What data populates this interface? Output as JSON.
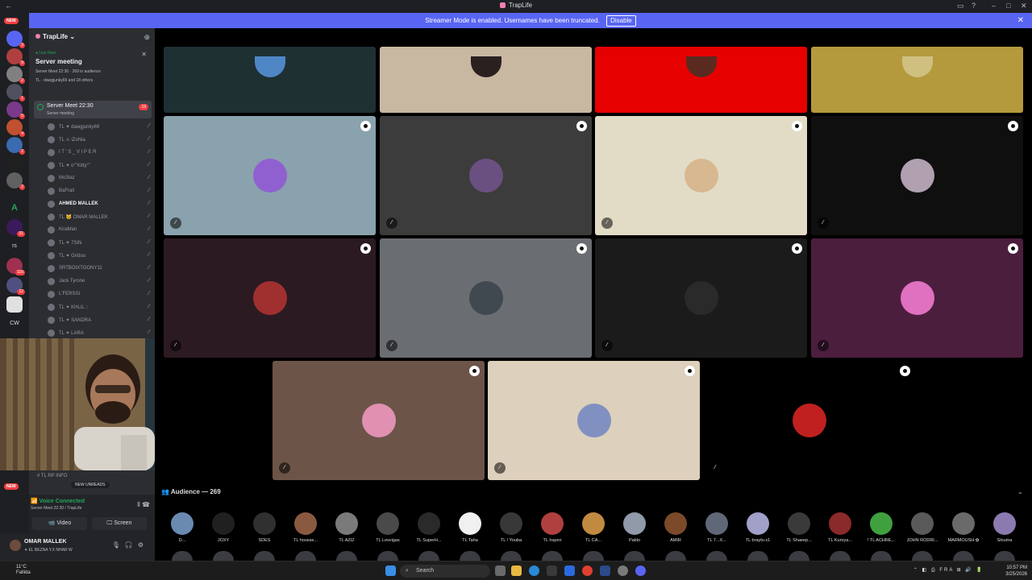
{
  "window": {
    "title": "TrapLife"
  },
  "banner": {
    "message": "Streamer Mode is enabled. Usernames have been truncated.",
    "disable_label": "Disable"
  },
  "rail": {
    "new_label": "NEW",
    "new_label_bottom": "NEW",
    "text_icon_1": "A",
    "text_icon_2": "rs",
    "text_icon_3": "CW"
  },
  "sidebar": {
    "server_name": "TrapLife",
    "live": {
      "status": "Live Now",
      "title": "Server meeting",
      "info": "Server Meet 22:30 · 269 in audience",
      "users": "TL · dawgjunky69 and 18 others"
    },
    "stage_channel": {
      "name": "Server Meet 22:30",
      "subtitle": "Server meeting",
      "count": "19"
    },
    "members": [
      "TL ✦ dawgjunky69",
      "TL ⚔ iZoNia",
      "I T ' S _ V I P E R",
      "TL ✦ o°˚Kitty°˚",
      "Mo3taz",
      "BaFrali",
      "AHMED MALLEK",
      "TL 🐱 OMAR MALLEK",
      "KiraMan",
      "TL ✦ 7SIN",
      "TL ✦ Gridou",
      "SRTBOIXTOONY11",
      "Jack Tyrone",
      "L'FERSSI",
      "TL ✦ KHLIL ::",
      "TL ✦ SANDRA",
      "TL ✦ LARA"
    ],
    "rp_channel": "TL RP INFO",
    "new_unreads": "NEW UNREADS",
    "voice": {
      "status": "Voice Connected",
      "sub": "Server Meet 22:30 / TrapLife",
      "video_label": "Video",
      "screen_label": "Screen"
    },
    "user": {
      "name": "OMAR MALLEK",
      "status": "✦ EL BEZNA Y.X NHAR W"
    }
  },
  "stage": {
    "tiles": [
      {
        "bg": "#1f3033",
        "avatar": "#4f86c6"
      },
      {
        "bg": "#c8b8a2",
        "avatar": "#2a2020"
      },
      {
        "bg": "#e60000",
        "avatar": "#5a2a20"
      },
      {
        "bg": "#b49a3c",
        "avatar": "#d0c080"
      },
      {
        "bg": "#8aa2ae",
        "avatar": "#9060d0"
      },
      {
        "bg": "#3c3c3c",
        "avatar": "#6a5080"
      },
      {
        "bg": "#e2dcc6",
        "avatar": "#d8b890"
      },
      {
        "bg": "#0f0f0f",
        "avatar": "#b0a0b0"
      },
      {
        "bg": "#2c1a22",
        "avatar": "#a03030"
      },
      {
        "bg": "#6a6e72",
        "avatar": "#404850"
      },
      {
        "bg": "#1b1b1b",
        "avatar": "#2a2a2a"
      },
      {
        "bg": "#4c1e3e",
        "avatar": "#e070c0"
      },
      {
        "bg": "#6c5448",
        "avatar": "#e090b0"
      },
      {
        "bg": "#ddd0bc",
        "avatar": "#8090c0"
      },
      {
        "bg": "#000000",
        "avatar": "#c02020"
      }
    ]
  },
  "audience": {
    "header": "Audience — 269",
    "members": [
      {
        "name": "D...",
        "color": "#6a8ab0"
      },
      {
        "name": "JOXY",
        "color": "#202020"
      },
      {
        "name": "SDES",
        "color": "#303030"
      },
      {
        "name": "TL housse...",
        "color": "#8a5a40"
      },
      {
        "name": "TL AZIZ",
        "color": "#7a7a7a"
      },
      {
        "name": "TL Lesvigas",
        "color": "#4a4a4a"
      },
      {
        "name": "TL SuperH...",
        "color": "#2a2a2a"
      },
      {
        "name": "TL Taha",
        "color": "#f0f0f0"
      },
      {
        "name": "TL ! Youba",
        "color": "#383838"
      },
      {
        "name": "TL Irayen",
        "color": "#b04040"
      },
      {
        "name": "TL CA...",
        "color": "#c08a40"
      },
      {
        "name": "Pablo",
        "color": "#909aa8"
      },
      {
        "name": "AMIR",
        "color": "#7a4a2a"
      },
      {
        "name": "TL 7...X...",
        "color": "#606878"
      },
      {
        "name": "TL brayto.x1",
        "color": "#a0a0c8"
      },
      {
        "name": "TL Shaeep...",
        "color": "#3a3a3a"
      },
      {
        "name": "TL Kuroya...",
        "color": "#8a2a2a"
      },
      {
        "name": "! TL ACHRE...",
        "color": "#40a040"
      },
      {
        "name": "JOHN RODRI...",
        "color": "#5a5a5a"
      },
      {
        "name": "MARMOUSH ✿",
        "color": "#6a6a6a"
      },
      {
        "name": "Slouma",
        "color": "#8a7ab0"
      }
    ]
  },
  "taskbar": {
    "weather_temp": "11°C",
    "weather_desc": "Fallida",
    "search_label": "Search",
    "lang": "FRA",
    "time": "10:57 PM",
    "date": "3/25/2026"
  }
}
